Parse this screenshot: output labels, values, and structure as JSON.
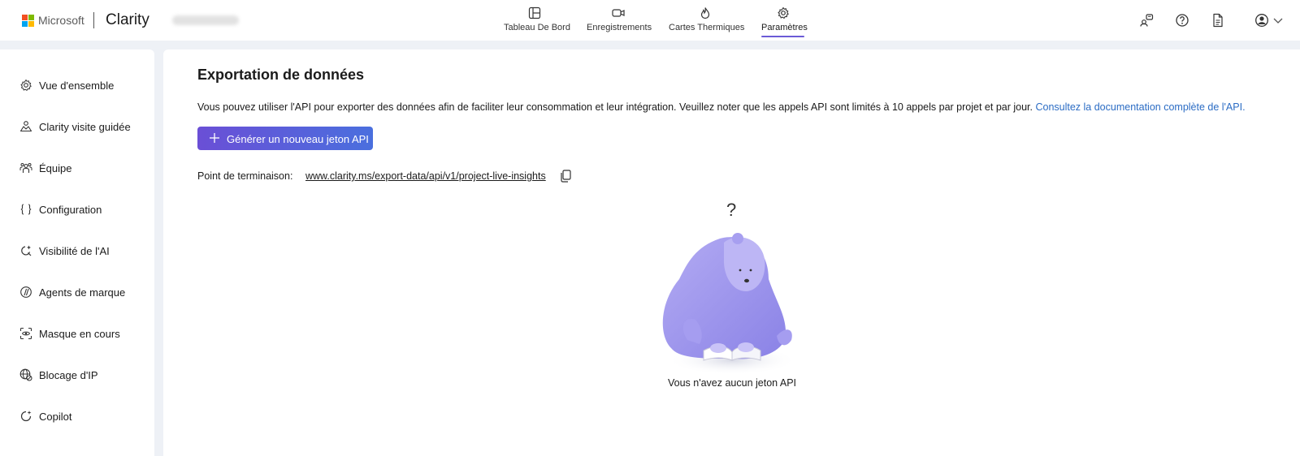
{
  "header": {
    "brand": "Microsoft",
    "product": "Clarity",
    "tabs": [
      {
        "label": "Tableau De Bord",
        "icon": "dashboard-icon"
      },
      {
        "label": "Enregistrements",
        "icon": "video-icon"
      },
      {
        "label": "Cartes Thermiques",
        "icon": "flame-icon"
      },
      {
        "label": "Paramètres",
        "icon": "gear-icon",
        "active": true
      }
    ],
    "right_icons": [
      "share-people-icon",
      "help-icon",
      "document-icon",
      "account-icon",
      "chevron-down-icon"
    ]
  },
  "sidebar": {
    "items": [
      {
        "label": "Vue d'ensemble",
        "icon": "gear-icon"
      },
      {
        "label": "Clarity visite guidée",
        "icon": "guided-tour-icon"
      },
      {
        "label": "Équipe",
        "icon": "team-icon"
      },
      {
        "label": "Configuration",
        "icon": "braces-icon"
      },
      {
        "label": "Visibilité de l'AI",
        "icon": "ai-visibility-icon"
      },
      {
        "label": "Agents de marque",
        "icon": "brand-agent-icon"
      },
      {
        "label": "Masque en cours",
        "icon": "masking-icon"
      },
      {
        "label": "Blocage d'IP",
        "icon": "globe-block-icon"
      },
      {
        "label": "Copilot",
        "icon": "copilot-icon"
      }
    ]
  },
  "main": {
    "title": "Exportation de données",
    "description": "Vous pouvez utiliser l'API pour exporter des données afin de faciliter leur consommation et leur intégration. Veuillez noter que les appels API sont limités à 10 appels par projet et par jour.",
    "doc_link": "Consultez la documentation complète de l'API.",
    "generate_button": "Générer un nouveau jeton API",
    "endpoint_label": "Point de terminaison:",
    "endpoint_url": "www.clarity.ms/export-data/api/v1/project-live-insights",
    "empty_mark": "?",
    "empty_text": "Vous n'avez aucun jeton API"
  },
  "colors": {
    "accent": "#6b5bd6",
    "button_start": "#6a4fd6",
    "button_end": "#4a6fde",
    "link": "#2b6cc4",
    "background": "#eef1f6"
  }
}
